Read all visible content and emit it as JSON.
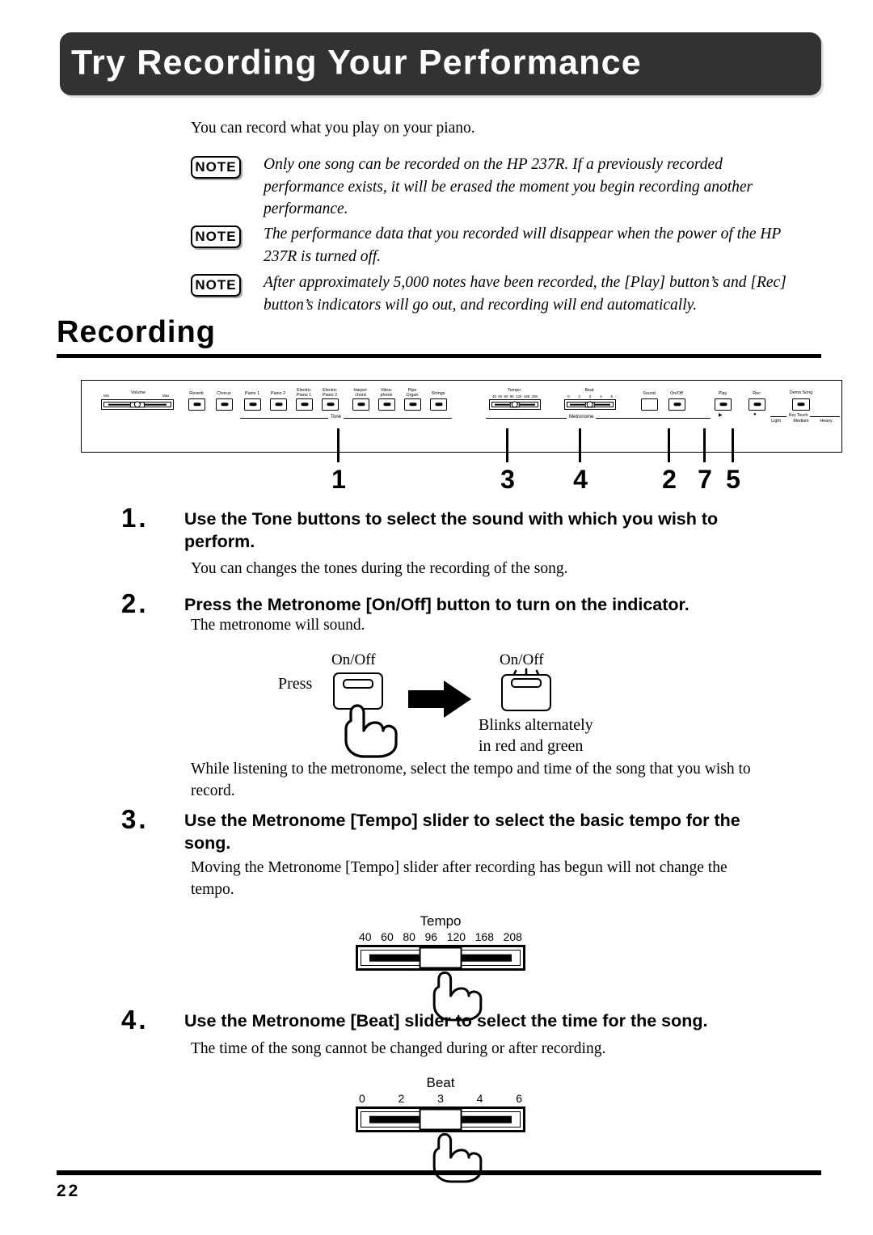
{
  "page": {
    "title": "Try Recording Your Performance",
    "section_heading": "Recording",
    "intro": "You can record what you play on your piano.",
    "page_number": "22"
  },
  "notes": {
    "badge_label": "NOTE",
    "items": [
      "Only one song can be recorded on the HP 237R. If a previously recorded performance exists, it will be erased the moment you begin recording another performance.",
      "The performance data that you recorded will disappear when the power of the HP 237R is turned off.",
      "After approximately 5,000 notes have been recorded, the [Play] button’s and [Rec] button’s indicators will go out, and recording will end automatically."
    ]
  },
  "panel": {
    "volume": {
      "label": "Volume",
      "min": "Min",
      "max": "Max"
    },
    "effects": [
      "Reverb",
      "Chorus"
    ],
    "tone": {
      "group_label": "Tone",
      "buttons": [
        "Piano 1",
        "Piano 2",
        "Electric Piano 1",
        "Electric Piano 2",
        "Harpsi- chord",
        "Vibra- phone",
        "Pipe Organ",
        "Strings"
      ],
      "buttons_l1": [
        "Piano 1",
        "Piano 2",
        "Electric",
        "Electric",
        "Harpsi-",
        "Vibra-",
        "Pipe",
        "Strings"
      ],
      "buttons_l2": [
        "",
        "",
        "Piano 1",
        "Piano 2",
        "chord",
        "phone",
        "Organ",
        ""
      ]
    },
    "metronome": {
      "group_label": "Metronome",
      "tempo_label": "Tempo",
      "tempo_scale": [
        "40",
        "60",
        "80",
        "96",
        "120",
        "168",
        "208"
      ],
      "beat_label": "Beat",
      "beat_scale": [
        "0",
        "2",
        "3",
        "4",
        "6"
      ],
      "sound_button": "Sound",
      "onoff_button": "On/Off"
    },
    "transport": {
      "play_button": "Play",
      "rec_button": "Rec",
      "play_symbol": "▶",
      "rec_symbol": "●"
    },
    "demo": {
      "demo_button": "Demo Song",
      "key_touch_label": "Key Touch",
      "key_touch_options": [
        "Light",
        "Medium",
        "Heavy"
      ]
    },
    "callouts": [
      "1",
      "3",
      "4",
      "2",
      "7",
      "5"
    ]
  },
  "steps": [
    {
      "number": "1.",
      "title": "Use the Tone buttons to select the sound with which you wish to perform.",
      "body": "You can changes the tones during the recording of the song."
    },
    {
      "number": "2.",
      "title": "Press the Metronome [On/Off] button to turn on the indicator.",
      "body": "The metronome will sound."
    },
    {
      "number": "3.",
      "title": "Use the Metronome [Tempo] slider to select the basic tempo for the song.",
      "body": "Moving the Metronome [Tempo] slider after recording has begun will not change the tempo."
    },
    {
      "number": "4.",
      "title": "Use the Metronome [Beat] slider to select the time for the song.",
      "body": "The time of the song cannot be changed during or after recording."
    }
  ],
  "figures": {
    "onoff": {
      "press_word": "Press",
      "button_label_left": "On/Off",
      "button_label_right": "On/Off",
      "result_line1": "Blinks alternately",
      "result_line2": "in red and green"
    },
    "interlude": "While listening to the metronome, select the tempo and time of the song that you wish to record.",
    "tempo_slider": {
      "title": "Tempo",
      "scale": [
        "40",
        "60",
        "80",
        "96",
        "120",
        "168",
        "208"
      ]
    },
    "beat_slider": {
      "title": "Beat",
      "scale": [
        "0",
        "2",
        "3",
        "4",
        "6"
      ]
    }
  }
}
